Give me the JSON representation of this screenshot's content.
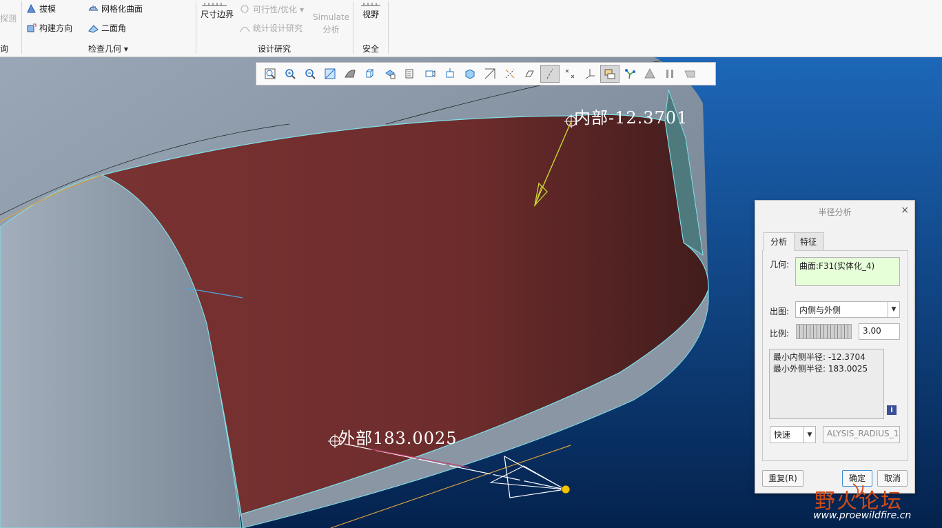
{
  "ribbon": {
    "col0": {
      "probe": "探测",
      "query": "询"
    },
    "inspect_geometry": {
      "draft": "拔模",
      "build_direction": "构建方向",
      "mesh_surface": "网格化曲面",
      "dihedral_angle": "二面角",
      "group_label": "检查几何"
    },
    "design_study": {
      "dimension_boundary": "尺寸边界",
      "feasibility": "可行性/优化",
      "statistical_design": "统计设计研究",
      "simulate": "Simulate",
      "analysis": "分析",
      "group_label": "设计研究"
    },
    "safety": {
      "view": "视野",
      "group_label": "安全"
    }
  },
  "view_toolbar": {
    "icons": [
      "refit-icon",
      "zoom-in-icon",
      "zoom-out-icon",
      "reorient-icon",
      "display-style-icon",
      "saved-views-icon",
      "view-manager-icon",
      "section-icon",
      "perspective-icon",
      "spin-center-icon",
      "annotation-display-icon",
      "plane-display-icon",
      "axis-display-icon",
      "point-display-icon",
      "csys-display-icon",
      "datum-display-icon",
      "annotation-toggle-icon",
      "coordinate-display-icon",
      "appearance-icon",
      "network-icon",
      "simulation-icon",
      "pause-icon",
      "regenerate-icon"
    ]
  },
  "annotations": {
    "inner": "内部-12.3701",
    "outer": "外部183.0025"
  },
  "dialog": {
    "title": "半径分析",
    "close": "×",
    "tabs": [
      "分析",
      "特征"
    ],
    "geometry_label": "几何:",
    "geometry_value": "曲面:F31(实体化_4)",
    "plot_label": "出图:",
    "plot_value": "内侧与外侧",
    "scale_label": "比例:",
    "scale_value": "3.00",
    "results": [
      "最小内侧半径: -12.3704",
      "最小外侧半径: 183.0025"
    ],
    "info_icon": "i",
    "mode_value": "快速",
    "name_value": "ALYSIS_RADIUS_1",
    "repeat_button": "重复(R)",
    "ok_button": "确定",
    "cancel_button": "取消"
  },
  "watermark": {
    "brand": "野火论坛",
    "url": "www.proewildfire.cn"
  },
  "colors": {
    "face": "#7a3232",
    "viewport_bg": "#0b3a78",
    "edge": "#7fe0e8",
    "arrow": "#c8d830"
  }
}
